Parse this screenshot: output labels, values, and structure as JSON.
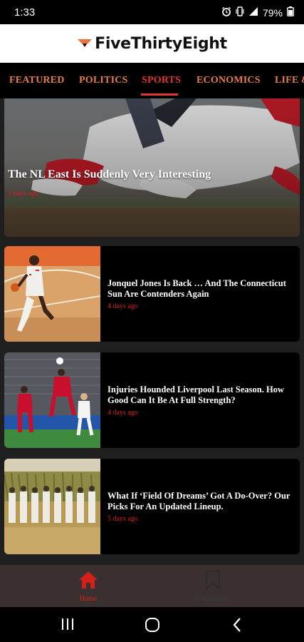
{
  "status_bar": {
    "time": "1:33",
    "battery": "79%",
    "icons": [
      "alarm-icon",
      "vibrate-icon",
      "signal-icon",
      "battery-icon"
    ]
  },
  "header": {
    "logo_text": "FiveThirtyEight",
    "logo_colors": {
      "mark": "#ed713c",
      "text": "#111111"
    }
  },
  "nav": {
    "tabs": [
      {
        "label": "FEATURED"
      },
      {
        "label": "POLITICS"
      },
      {
        "label": "SPORTS",
        "active": true
      },
      {
        "label": "ECONOMICS"
      },
      {
        "label": "LIFE &"
      }
    ]
  },
  "feed": {
    "hero": {
      "title": "The NL East Is Suddenly Very Interesting",
      "time": "3 days ago"
    },
    "articles": [
      {
        "title": "Jonquel Jones Is Back … And The Connecticut Sun Are Contenders Again",
        "time": "4 days ago",
        "thumb": "basketball-photo"
      },
      {
        "title": "Injuries Hounded Liverpool Last Season. How Good Can It Be At Full Strength?",
        "time": "4 days ago",
        "thumb": "soccer-photo"
      },
      {
        "title": "What If ‘Field Of Dreams’ Got A Do-Over? Our Picks For An Updated Lineup.",
        "time": "5 days ago",
        "thumb": "baseball-field-photo"
      }
    ]
  },
  "bottom_nav": {
    "items": [
      {
        "label": "Home",
        "icon": "home-icon",
        "active": true
      },
      {
        "label": "Collections",
        "icon": "bookmark-icon",
        "active": false
      }
    ]
  },
  "system_nav": {
    "buttons": [
      "recents-icon",
      "home-circle-icon",
      "back-icon"
    ]
  },
  "colors": {
    "accent_red": "#d4201a",
    "tab_orange": "#e37e4c",
    "active_tab": "#e0352c",
    "card_bg": "#000000",
    "feed_bg": "#1f1f1f",
    "bottom_nav_bg": "#3b3030"
  }
}
